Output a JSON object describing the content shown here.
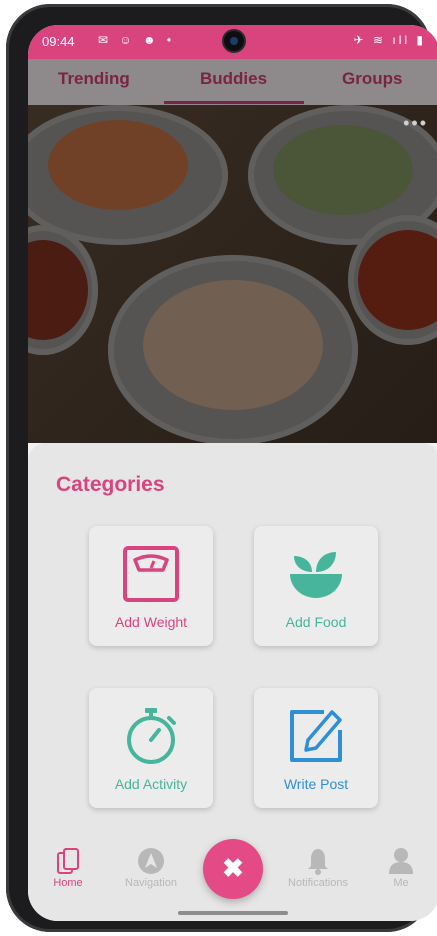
{
  "status": {
    "time": "09:44",
    "left_icons": "✉ ☺ ☻ •",
    "right_icons": "✈ ≋ ıll ▮"
  },
  "tabs": [
    {
      "label": "Trending"
    },
    {
      "label": "Buddies"
    },
    {
      "label": "Groups"
    }
  ],
  "sheet": {
    "title": "Categories",
    "cards": [
      {
        "label": "Add Weight",
        "color": "#d9447f",
        "icon": "scale-icon"
      },
      {
        "label": "Add Food",
        "color": "#46b59b",
        "icon": "food-bowl-icon"
      },
      {
        "label": "Add Activity",
        "color": "#46b59b",
        "icon": "stopwatch-icon"
      },
      {
        "label": "Write Post",
        "color": "#2f8fd6",
        "icon": "edit-icon"
      }
    ]
  },
  "nav": {
    "items": [
      {
        "label": "Home"
      },
      {
        "label": "Navigation"
      },
      {
        "label": "Notifications"
      },
      {
        "label": "Me"
      }
    ],
    "close_glyph": "✖"
  },
  "colors": {
    "accent": "#d9447f",
    "green": "#46b59b",
    "blue": "#2f8fd6"
  }
}
